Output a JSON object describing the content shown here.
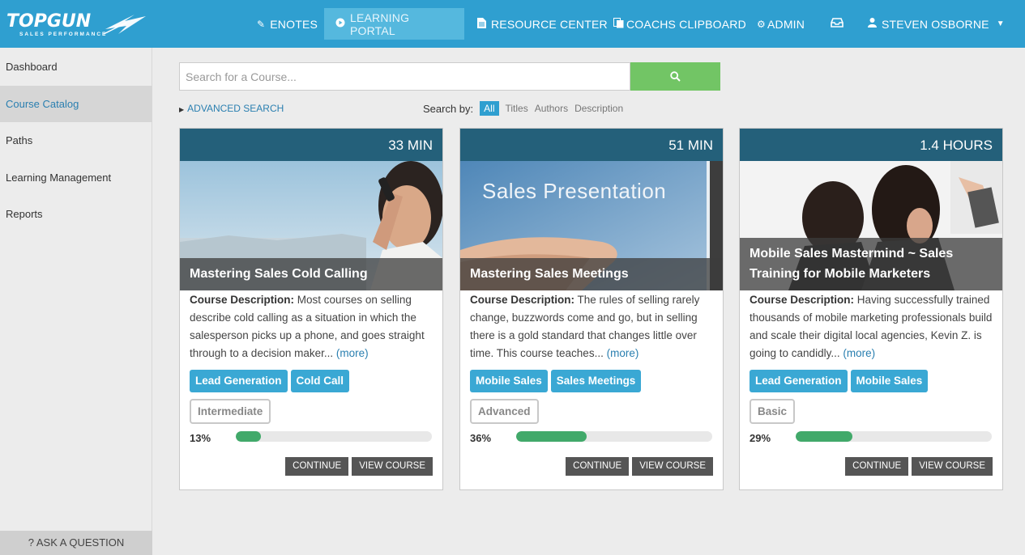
{
  "brand": {
    "logo_text": "TOPGUN",
    "logo_sub": "SALES PERFORMANCE"
  },
  "nav": [
    {
      "label": "ENOTES",
      "icon": "pencil-icon"
    },
    {
      "label": "LEARNING PORTAL",
      "icon": "play-circle-icon",
      "active": true
    },
    {
      "label": "RESOURCE CENTER",
      "icon": "document-icon"
    },
    {
      "label": "COACHS CLIPBOARD",
      "icon": "clipboard-icon"
    },
    {
      "label": "ADMIN",
      "icon": "gears-icon"
    },
    {
      "label": "",
      "icon": "inbox-icon"
    },
    {
      "label": "STEVEN OSBORNE",
      "icon": "user-icon"
    }
  ],
  "sidebar": {
    "items": [
      {
        "label": "Dashboard"
      },
      {
        "label": "Course Catalog",
        "active": true
      },
      {
        "label": "Paths"
      },
      {
        "label": "Learning Management"
      },
      {
        "label": "Reports"
      }
    ],
    "ask": "? ASK A QUESTION"
  },
  "search": {
    "placeholder": "Search for a Course...",
    "value": "",
    "advanced": "ADVANCED SEARCH",
    "search_by_label": "Search by:",
    "options": [
      "All",
      "Titles",
      "Authors",
      "Description"
    ],
    "selected": "All"
  },
  "colors": {
    "topbar": "#2f9fd0",
    "header_band": "#24607a",
    "search_button": "#72c565",
    "tag": "#3aa8d4",
    "progress": "#41a96a"
  },
  "courses": [
    {
      "duration": "33 MIN",
      "title": "Mastering Sales Cold Calling",
      "desc_label": "Course Description:",
      "description": "Most courses on selling describe cold calling as a situation in which the salesperson picks up a phone, and goes straight through to a decision maker...",
      "more": "(more)",
      "tags": [
        "Lead Generation",
        "Cold Call"
      ],
      "level": "Intermediate",
      "progress_label": "13%",
      "progress": 0.13,
      "continue": "CONTINUE",
      "view": "VIEW COURSE"
    },
    {
      "duration": "51 MIN",
      "title": "Mastering Sales Meetings",
      "image_text": "Sales Presentation",
      "desc_label": "Course Description:",
      "description": "The rules of selling rarely change, buzzwords come and go, but in selling there is a gold standard that changes little over time. This course teaches...",
      "more": "(more)",
      "tags": [
        "Mobile Sales",
        "Sales Meetings"
      ],
      "level": "Advanced",
      "progress_label": "36%",
      "progress": 0.36,
      "continue": "CONTINUE",
      "view": "VIEW COURSE"
    },
    {
      "duration": "1.4 HOURS",
      "title": "Mobile Sales Mastermind ~ Sales Training for Mobile Marketers",
      "desc_label": "Course Description:",
      "description": "Having successfully trained thousands of mobile marketing professionals build and scale their digital local agencies, Kevin Z. is going to candidly...",
      "more": "(more)",
      "tags": [
        "Lead Generation",
        "Mobile Sales"
      ],
      "level": "Basic",
      "progress_label": "29%",
      "progress": 0.29,
      "continue": "CONTINUE",
      "view": "VIEW COURSE"
    }
  ]
}
